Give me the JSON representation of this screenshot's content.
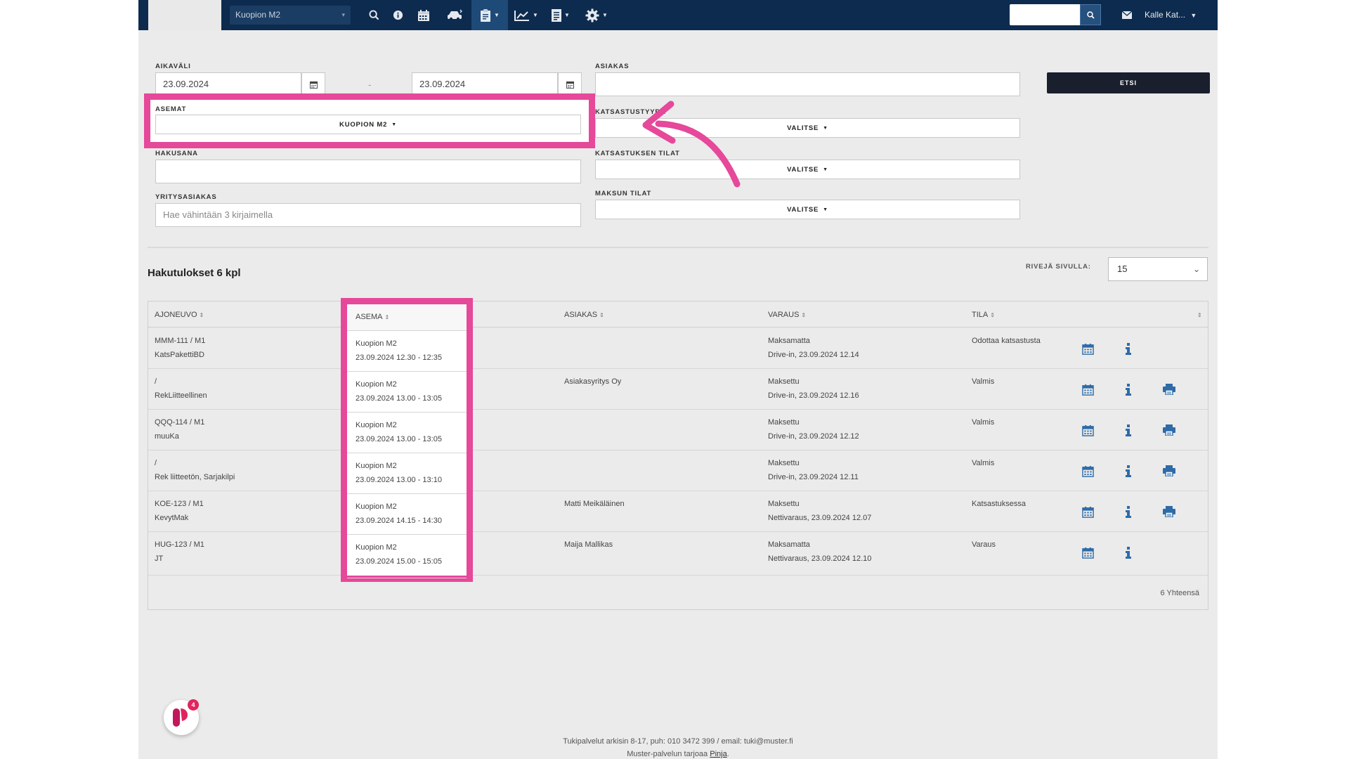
{
  "navbar": {
    "station_value": "Kuopion M2",
    "user_label": "Kalle Kat...",
    "icons": [
      "search-icon",
      "info-icon",
      "calendar-icon",
      "car-icon",
      "clipboard-icon",
      "chart-icon",
      "document-icon",
      "gear-icon",
      "mail-icon"
    ],
    "accent": "#0d2b4e"
  },
  "filters": {
    "aikavali_label": "AIKAVÄLI",
    "date_from": "23.09.2024",
    "date_separator": "-",
    "date_to": "23.09.2024",
    "asiakas_label": "ASIAKAS",
    "asiakas_value": "",
    "search_button": "ETSI",
    "asemat_label": "ASEMAT",
    "asemat_value": "KUOPION M2",
    "katsastustyypit_label": "KATSASTUSTYYPIT",
    "katsastustyypit_value": "VALITSE",
    "hakusana_label": "HAKUSANA",
    "hakusana_value": "",
    "katsastuksen_tilat_label": "KATSASTUKSEN TILAT",
    "katsastuksen_tilat_value": "VALITSE",
    "yritysasiakas_label": "YRITYSASIAKAS",
    "yritysasiakas_placeholder": "Hae vähintään 3 kirjaimella",
    "maksun_tilat_label": "MAKSUN TILAT",
    "maksun_tilat_value": "VALITSE"
  },
  "results": {
    "title": "Hakutulokset 6 kpl",
    "rows_label": "RIVEJÄ SIVULLA:",
    "rows_value": "15",
    "total": "6 Yhteensä"
  },
  "table": {
    "headers": {
      "ajoneuvo": "AJONEUVO",
      "asema": "ASEMA",
      "asiakas": "ASIAKAS",
      "varaus": "VARAUS",
      "tila": "TILA"
    },
    "rows": [
      {
        "vehicle": "MMM-111 / M1",
        "vehicle_sub": "KatsPakettiBD",
        "station": "Kuopion M2",
        "time": "23.09.2024 12.30 - 12:35",
        "customer": "",
        "payment": "Maksamatta",
        "booking": "Drive-in, 23.09.2024 12.14",
        "status": "Odottaa katsastusta",
        "print": false
      },
      {
        "vehicle": "/",
        "vehicle_sub": "RekLiitteellinen",
        "station": "Kuopion M2",
        "time": "23.09.2024 13.00 - 13:05",
        "customer": "Asiakasyritys Oy",
        "payment": "Maksettu",
        "booking": "Drive-in, 23.09.2024 12.16",
        "status": "Valmis",
        "print": true
      },
      {
        "vehicle": "QQQ-114 / M1",
        "vehicle_sub": "muuKa",
        "station": "Kuopion M2",
        "time": "23.09.2024 13.00 - 13:05",
        "customer": "",
        "payment": "Maksettu",
        "booking": "Drive-in, 23.09.2024 12.12",
        "status": "Valmis",
        "print": true
      },
      {
        "vehicle": "/",
        "vehicle_sub": "Rek liitteetön, Sarjakilpi",
        "station": "Kuopion M2",
        "time": "23.09.2024 13.00 - 13:10",
        "customer": "",
        "payment": "Maksettu",
        "booking": "Drive-in, 23.09.2024 12.11",
        "status": "Valmis",
        "print": true
      },
      {
        "vehicle": "KOE-123 / M1",
        "vehicle_sub": "KevytMak",
        "station": "Kuopion M2",
        "time": "23.09.2024 14.15 - 14:30",
        "customer": "Matti Meikäläinen",
        "payment": "Maksettu",
        "booking": "Nettivaraus, 23.09.2024 12.07",
        "status": "Katsastuksessa",
        "print": true
      },
      {
        "vehicle": "HUG-123 / M1",
        "vehicle_sub": "JT",
        "station": "Kuopion M2",
        "time": "23.09.2024 15.00 - 15:05",
        "customer": "Maija Mallikas",
        "payment": "Maksamatta",
        "booking": "Nettivaraus, 23.09.2024 12.10",
        "status": "Varaus",
        "print": false
      }
    ]
  },
  "footer": {
    "support_text": "Tukipalvelut arkisin 8-17, puh: 010 3472 399 / email: tuki@muster.fi",
    "provider_prefix": "Muster-palvelun tarjoaa ",
    "provider_link": "Pinja",
    "provider_suffix": "."
  },
  "chat": {
    "badge_count": "4"
  },
  "highlight_color": "#e6489a"
}
